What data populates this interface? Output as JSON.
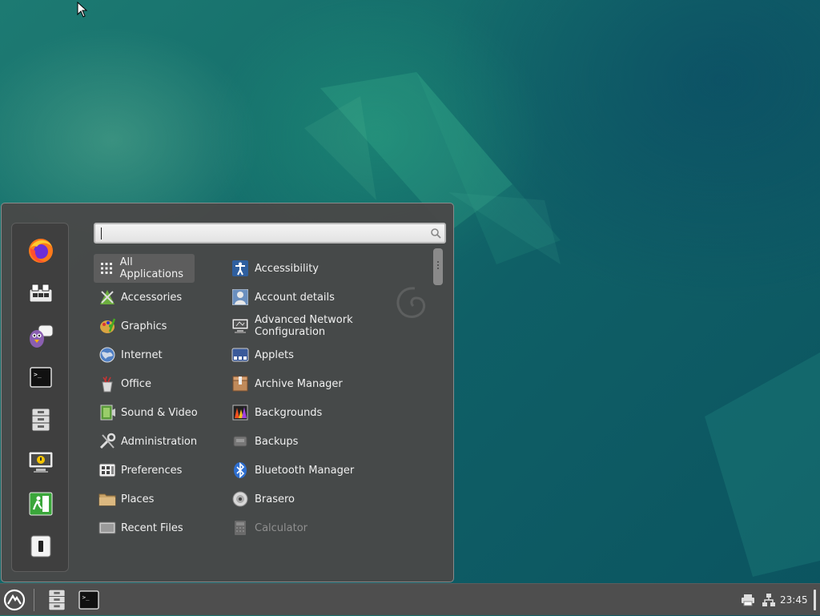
{
  "search": {
    "value": "",
    "placeholder": ""
  },
  "categories": [
    {
      "label": "All Applications",
      "icon": "grid-icon",
      "selected": true
    },
    {
      "label": "Accessories",
      "icon": "accessories-icon"
    },
    {
      "label": "Graphics",
      "icon": "graphics-icon"
    },
    {
      "label": "Internet",
      "icon": "globe-icon"
    },
    {
      "label": "Office",
      "icon": "office-icon"
    },
    {
      "label": "Sound & Video",
      "icon": "film-icon"
    },
    {
      "label": "Administration",
      "icon": "tools-icon"
    },
    {
      "label": "Preferences",
      "icon": "preferences-icon"
    },
    {
      "label": "Places",
      "icon": "folder-icon"
    },
    {
      "label": "Recent Files",
      "icon": "recent-files-icon"
    }
  ],
  "apps": [
    {
      "label": "Accessibility",
      "icon": "accessibility-icon"
    },
    {
      "label": "Account details",
      "icon": "user-icon"
    },
    {
      "label": "Advanced Network Configuration",
      "icon": "network-config-icon"
    },
    {
      "label": "Applets",
      "icon": "applets-icon"
    },
    {
      "label": "Archive Manager",
      "icon": "archive-icon"
    },
    {
      "label": "Backgrounds",
      "icon": "backgrounds-icon"
    },
    {
      "label": "Backups",
      "icon": "backups-icon"
    },
    {
      "label": "Bluetooth Manager",
      "icon": "bluetooth-icon"
    },
    {
      "label": "Brasero",
      "icon": "disc-icon"
    },
    {
      "label": "Calculator",
      "icon": "calculator-icon"
    }
  ],
  "favorites": [
    "firefox-icon",
    "software-manager-icon",
    "pidgin-icon",
    "terminal-icon",
    "file-cabinet-icon",
    "lock-screen-icon",
    "logout-icon",
    "shutdown-icon"
  ],
  "panel": {
    "clock": "23:45"
  },
  "colors": {
    "menu_bg": "#484848",
    "panel_bg": "#4e4e4e",
    "desktop": "#156f6c"
  }
}
